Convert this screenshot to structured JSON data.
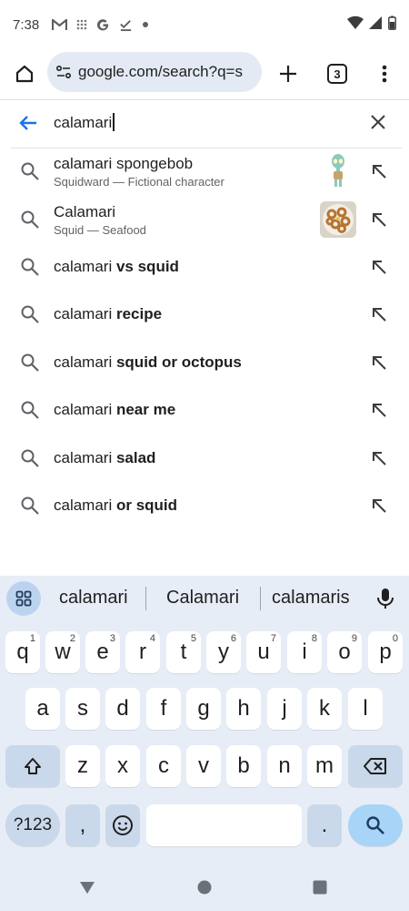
{
  "status": {
    "time": "7:38",
    "left_icons": [
      "gmail-icon",
      "grid-dots-icon",
      "google-g-icon",
      "check-icon",
      "dot-icon"
    ],
    "right_icons": [
      "wifi-icon",
      "signal-icon",
      "battery-icon"
    ]
  },
  "toolbar": {
    "url": "google.com/search?q=s",
    "tab_count": "3"
  },
  "search": {
    "query": "calamari"
  },
  "suggestions": [
    {
      "main_plain": "calamari spongebob",
      "main_bold": "",
      "sub": "Squidward — Fictional character",
      "thumb": "squidward"
    },
    {
      "main_plain": "Calamari",
      "main_bold": "",
      "sub": "Squid — Seafood",
      "thumb": "calamari-dish"
    },
    {
      "main_plain": "calamari ",
      "main_bold": "vs squid",
      "sub": ""
    },
    {
      "main_plain": "calamari ",
      "main_bold": "recipe",
      "sub": ""
    },
    {
      "main_plain": "calamari ",
      "main_bold": "squid or octopus",
      "sub": ""
    },
    {
      "main_plain": "calamari ",
      "main_bold": "near me",
      "sub": ""
    },
    {
      "main_plain": "calamari ",
      "main_bold": "salad",
      "sub": ""
    },
    {
      "main_plain": "calamari ",
      "main_bold": "or squid",
      "sub": ""
    }
  ],
  "keyboard": {
    "word_suggestions": [
      "calamari",
      "Calamari",
      "calamaris"
    ],
    "row1": [
      {
        "k": "q",
        "h": "1"
      },
      {
        "k": "w",
        "h": "2"
      },
      {
        "k": "e",
        "h": "3"
      },
      {
        "k": "r",
        "h": "4"
      },
      {
        "k": "t",
        "h": "5"
      },
      {
        "k": "y",
        "h": "6"
      },
      {
        "k": "u",
        "h": "7"
      },
      {
        "k": "i",
        "h": "8"
      },
      {
        "k": "o",
        "h": "9"
      },
      {
        "k": "p",
        "h": "0"
      }
    ],
    "row2": [
      "a",
      "s",
      "d",
      "f",
      "g",
      "h",
      "j",
      "k",
      "l"
    ],
    "row3": [
      "z",
      "x",
      "c",
      "v",
      "b",
      "n",
      "m"
    ],
    "symbols_label": "?123",
    "comma": ",",
    "period": "."
  },
  "colors": {
    "accent_blue": "#1a73e8",
    "url_pill": "#e4eaf3",
    "keyboard_bg": "#e7edf6",
    "search_key": "#a7d4f7"
  }
}
